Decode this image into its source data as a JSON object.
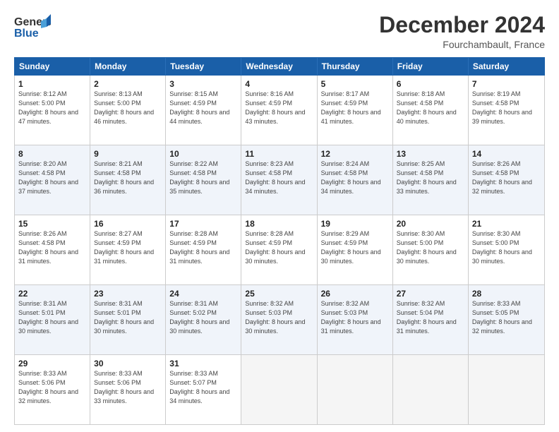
{
  "header": {
    "logo_line1": "General",
    "logo_line2": "Blue",
    "month_title": "December 2024",
    "subtitle": "Fourchambault, France"
  },
  "days_of_week": [
    "Sunday",
    "Monday",
    "Tuesday",
    "Wednesday",
    "Thursday",
    "Friday",
    "Saturday"
  ],
  "weeks": [
    [
      {
        "day": "1",
        "sunrise": "Sunrise: 8:12 AM",
        "sunset": "Sunset: 5:00 PM",
        "daylight": "Daylight: 8 hours and 47 minutes."
      },
      {
        "day": "2",
        "sunrise": "Sunrise: 8:13 AM",
        "sunset": "Sunset: 5:00 PM",
        "daylight": "Daylight: 8 hours and 46 minutes."
      },
      {
        "day": "3",
        "sunrise": "Sunrise: 8:15 AM",
        "sunset": "Sunset: 4:59 PM",
        "daylight": "Daylight: 8 hours and 44 minutes."
      },
      {
        "day": "4",
        "sunrise": "Sunrise: 8:16 AM",
        "sunset": "Sunset: 4:59 PM",
        "daylight": "Daylight: 8 hours and 43 minutes."
      },
      {
        "day": "5",
        "sunrise": "Sunrise: 8:17 AM",
        "sunset": "Sunset: 4:59 PM",
        "daylight": "Daylight: 8 hours and 41 minutes."
      },
      {
        "day": "6",
        "sunrise": "Sunrise: 8:18 AM",
        "sunset": "Sunset: 4:58 PM",
        "daylight": "Daylight: 8 hours and 40 minutes."
      },
      {
        "day": "7",
        "sunrise": "Sunrise: 8:19 AM",
        "sunset": "Sunset: 4:58 PM",
        "daylight": "Daylight: 8 hours and 39 minutes."
      }
    ],
    [
      {
        "day": "8",
        "sunrise": "Sunrise: 8:20 AM",
        "sunset": "Sunset: 4:58 PM",
        "daylight": "Daylight: 8 hours and 37 minutes."
      },
      {
        "day": "9",
        "sunrise": "Sunrise: 8:21 AM",
        "sunset": "Sunset: 4:58 PM",
        "daylight": "Daylight: 8 hours and 36 minutes."
      },
      {
        "day": "10",
        "sunrise": "Sunrise: 8:22 AM",
        "sunset": "Sunset: 4:58 PM",
        "daylight": "Daylight: 8 hours and 35 minutes."
      },
      {
        "day": "11",
        "sunrise": "Sunrise: 8:23 AM",
        "sunset": "Sunset: 4:58 PM",
        "daylight": "Daylight: 8 hours and 34 minutes."
      },
      {
        "day": "12",
        "sunrise": "Sunrise: 8:24 AM",
        "sunset": "Sunset: 4:58 PM",
        "daylight": "Daylight: 8 hours and 34 minutes."
      },
      {
        "day": "13",
        "sunrise": "Sunrise: 8:25 AM",
        "sunset": "Sunset: 4:58 PM",
        "daylight": "Daylight: 8 hours and 33 minutes."
      },
      {
        "day": "14",
        "sunrise": "Sunrise: 8:26 AM",
        "sunset": "Sunset: 4:58 PM",
        "daylight": "Daylight: 8 hours and 32 minutes."
      }
    ],
    [
      {
        "day": "15",
        "sunrise": "Sunrise: 8:26 AM",
        "sunset": "Sunset: 4:58 PM",
        "daylight": "Daylight: 8 hours and 31 minutes."
      },
      {
        "day": "16",
        "sunrise": "Sunrise: 8:27 AM",
        "sunset": "Sunset: 4:59 PM",
        "daylight": "Daylight: 8 hours and 31 minutes."
      },
      {
        "day": "17",
        "sunrise": "Sunrise: 8:28 AM",
        "sunset": "Sunset: 4:59 PM",
        "daylight": "Daylight: 8 hours and 31 minutes."
      },
      {
        "day": "18",
        "sunrise": "Sunrise: 8:28 AM",
        "sunset": "Sunset: 4:59 PM",
        "daylight": "Daylight: 8 hours and 30 minutes."
      },
      {
        "day": "19",
        "sunrise": "Sunrise: 8:29 AM",
        "sunset": "Sunset: 4:59 PM",
        "daylight": "Daylight: 8 hours and 30 minutes."
      },
      {
        "day": "20",
        "sunrise": "Sunrise: 8:30 AM",
        "sunset": "Sunset: 5:00 PM",
        "daylight": "Daylight: 8 hours and 30 minutes."
      },
      {
        "day": "21",
        "sunrise": "Sunrise: 8:30 AM",
        "sunset": "Sunset: 5:00 PM",
        "daylight": "Daylight: 8 hours and 30 minutes."
      }
    ],
    [
      {
        "day": "22",
        "sunrise": "Sunrise: 8:31 AM",
        "sunset": "Sunset: 5:01 PM",
        "daylight": "Daylight: 8 hours and 30 minutes."
      },
      {
        "day": "23",
        "sunrise": "Sunrise: 8:31 AM",
        "sunset": "Sunset: 5:01 PM",
        "daylight": "Daylight: 8 hours and 30 minutes."
      },
      {
        "day": "24",
        "sunrise": "Sunrise: 8:31 AM",
        "sunset": "Sunset: 5:02 PM",
        "daylight": "Daylight: 8 hours and 30 minutes."
      },
      {
        "day": "25",
        "sunrise": "Sunrise: 8:32 AM",
        "sunset": "Sunset: 5:03 PM",
        "daylight": "Daylight: 8 hours and 30 minutes."
      },
      {
        "day": "26",
        "sunrise": "Sunrise: 8:32 AM",
        "sunset": "Sunset: 5:03 PM",
        "daylight": "Daylight: 8 hours and 31 minutes."
      },
      {
        "day": "27",
        "sunrise": "Sunrise: 8:32 AM",
        "sunset": "Sunset: 5:04 PM",
        "daylight": "Daylight: 8 hours and 31 minutes."
      },
      {
        "day": "28",
        "sunrise": "Sunrise: 8:33 AM",
        "sunset": "Sunset: 5:05 PM",
        "daylight": "Daylight: 8 hours and 32 minutes."
      }
    ],
    [
      {
        "day": "29",
        "sunrise": "Sunrise: 8:33 AM",
        "sunset": "Sunset: 5:06 PM",
        "daylight": "Daylight: 8 hours and 32 minutes."
      },
      {
        "day": "30",
        "sunrise": "Sunrise: 8:33 AM",
        "sunset": "Sunset: 5:06 PM",
        "daylight": "Daylight: 8 hours and 33 minutes."
      },
      {
        "day": "31",
        "sunrise": "Sunrise: 8:33 AM",
        "sunset": "Sunset: 5:07 PM",
        "daylight": "Daylight: 8 hours and 34 minutes."
      },
      null,
      null,
      null,
      null
    ]
  ]
}
